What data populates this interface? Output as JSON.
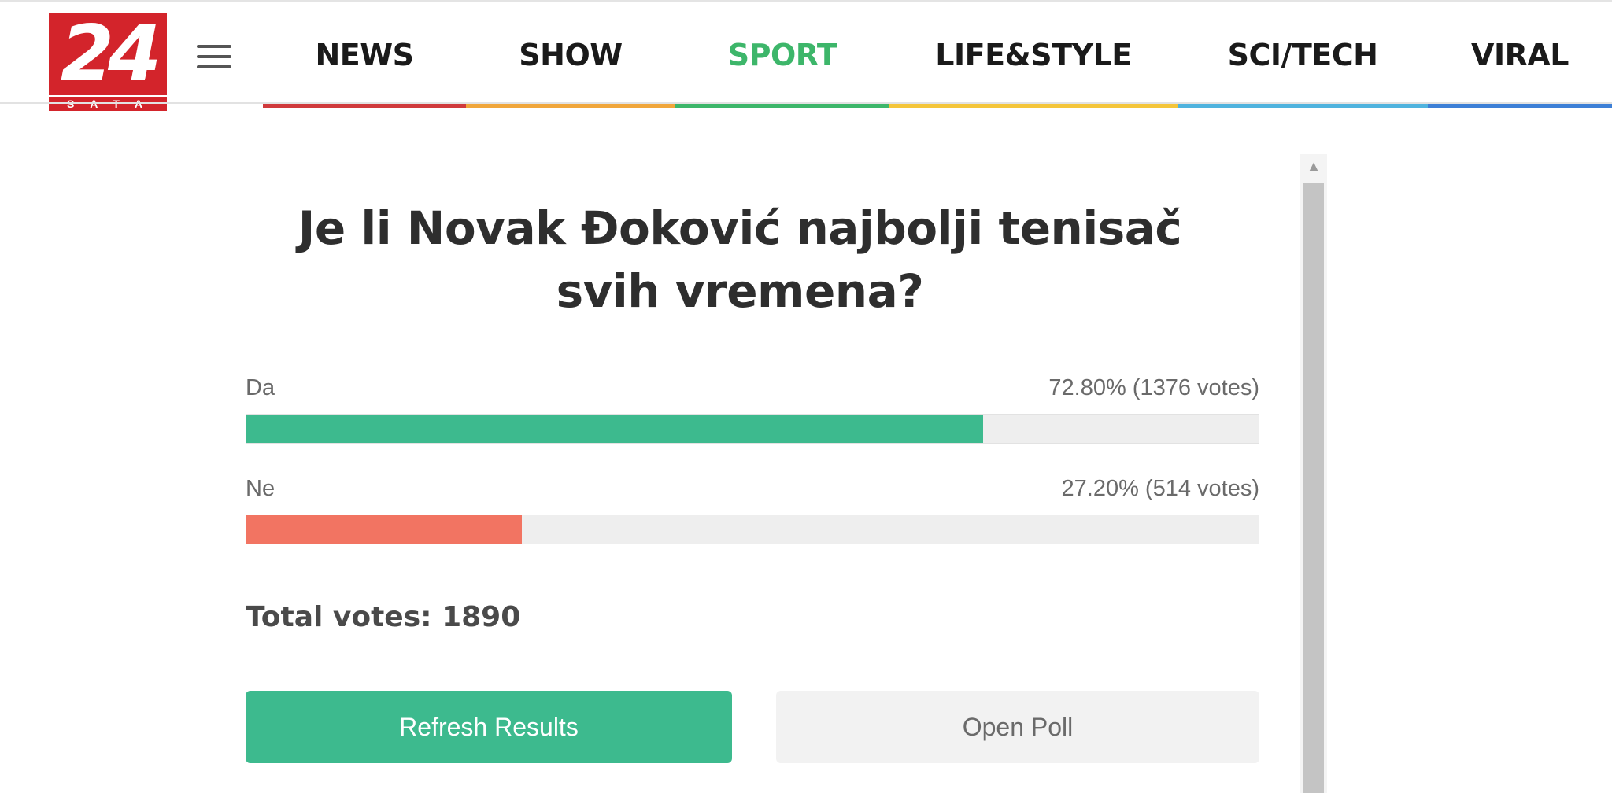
{
  "logo": {
    "digits": "24",
    "sub": "SATA",
    "color": "#d3242b"
  },
  "nav": {
    "items": [
      {
        "label": "NEWS",
        "color": "#d03a3c",
        "active": false
      },
      {
        "label": "SHOW",
        "color": "#f0a63b",
        "active": false
      },
      {
        "label": "SPORT",
        "color": "#3db66a",
        "active": true
      },
      {
        "label": "LIFE&STYLE",
        "color": "#f4c53a",
        "active": false
      },
      {
        "label": "SCI/TECH",
        "color": "#4fb3de",
        "active": false
      },
      {
        "label": "VIRAL",
        "color": "#3d7fd6",
        "active": false
      }
    ],
    "active_text_color": "#3db66a"
  },
  "poll": {
    "title_line1": "Je li Novak Đoković najbolji tenisač",
    "title_line2": "svih vremena?",
    "options": [
      {
        "label": "Da",
        "result": "72.80% (1376 votes)",
        "fraction": 0.728,
        "color": "#3dba8e"
      },
      {
        "label": "Ne",
        "result": "27.20% (514 votes)",
        "fraction": 0.272,
        "color": "#f27462"
      }
    ],
    "total": "Total votes: 1890",
    "refresh_label": "Refresh Results",
    "open_label": "Open Poll"
  },
  "scrollbar": {
    "up_icon": "chevron-up-icon"
  }
}
